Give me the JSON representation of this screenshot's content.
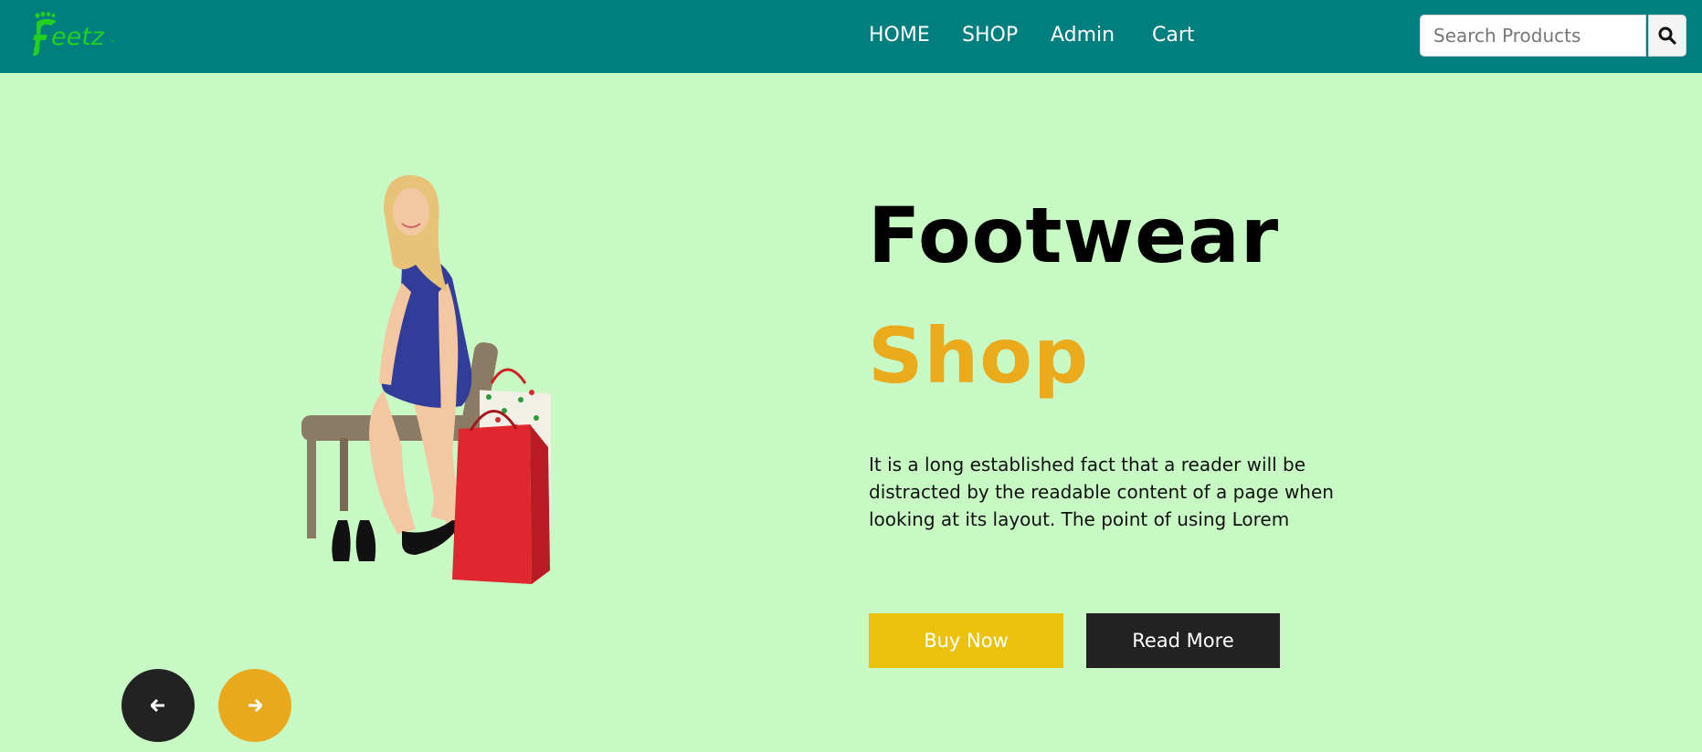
{
  "brand": {
    "logo_text": "feetz",
    "logo_color": "#20d023"
  },
  "colors": {
    "navbar": "#017e7e",
    "background": "#c8f9c5",
    "accent": "#eba91c",
    "buy_button": "#eac20b",
    "dark": "#222222"
  },
  "nav": {
    "links": [
      {
        "label": "HOME"
      },
      {
        "label": "SHOP"
      },
      {
        "label": "Admin"
      },
      {
        "label": "Cart"
      }
    ]
  },
  "search": {
    "placeholder": "Search Products",
    "icon": "search-icon"
  },
  "hero": {
    "title_line1": "Footwear",
    "title_line2": "Shop",
    "text": "It is a long established fact that a reader will be distracted by the readable content of a page when looking at its layout. The point of using Lorem",
    "buy_label": "Buy Now",
    "read_label": "Read More",
    "image": "woman-trying-shoes-illustration"
  },
  "carousel": {
    "prev_icon": "arrow-left-icon",
    "next_icon": "arrow-right-icon"
  }
}
